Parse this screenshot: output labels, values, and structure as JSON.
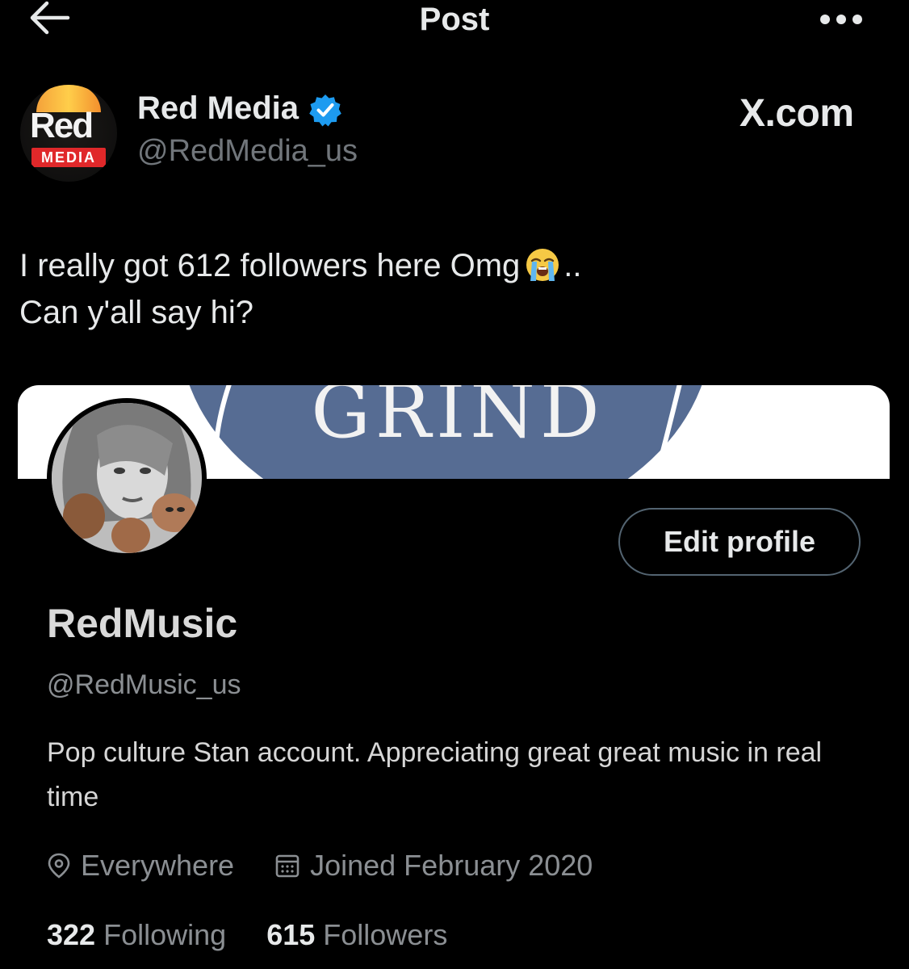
{
  "topbar": {
    "title": "Post",
    "back_icon": "arrow-left-icon",
    "more_icon": "more-horizontal-icon"
  },
  "post": {
    "author_name": "Red Media",
    "author_handle": "@RedMedia_us",
    "verified_icon": "verified-badge-icon",
    "watermark": "X.com",
    "logo": {
      "word": "Red",
      "tag": "MEDIA"
    },
    "text_line1_a": "I really got 612 followers here Omg",
    "text_line1_b": "..",
    "text_line2": "Can y'all say hi?",
    "emoji": "loudly-crying-face"
  },
  "embedded_profile": {
    "banner_text": "GRIND",
    "edit_profile_label": "Edit profile",
    "name": "RedMusic",
    "handle": "@RedMusic_us",
    "bio": "Pop culture Stan account. Appreciating great great music in real time",
    "location": "Everywhere",
    "joined": "Joined February 2020",
    "following_count": "322",
    "following_label": "Following",
    "followers_count": "615",
    "followers_label": "Followers"
  },
  "colors": {
    "background": "#000000",
    "text_primary": "#e7e9ea",
    "text_secondary": "#71767b",
    "verified_blue": "#1d9bf0",
    "logo_red": "#e0282a"
  }
}
